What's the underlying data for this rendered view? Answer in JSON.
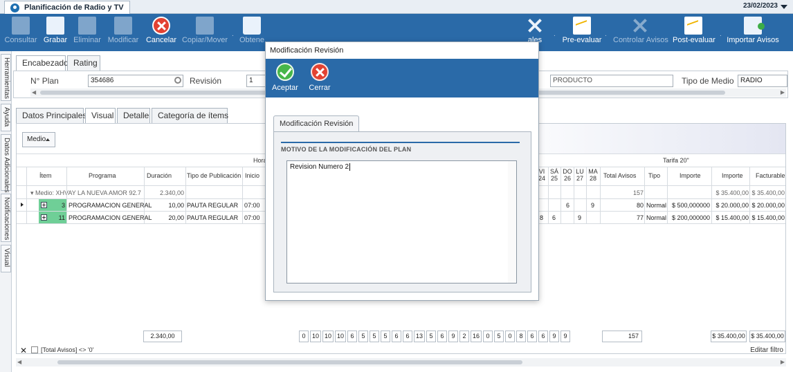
{
  "window": {
    "title": "Planificación de Radio y TV",
    "date": "23/02/2023"
  },
  "toolbar": {
    "buttons": [
      {
        "label": "Consultar",
        "icon": "consult-doc-icon"
      },
      {
        "label": "Grabar",
        "icon": "save-disk-icon"
      },
      {
        "label": "Eliminar",
        "icon": "delete-doc-icon"
      },
      {
        "label": "Modificar",
        "icon": "edit-doc-icon"
      },
      {
        "label": "Cancelar",
        "icon": "cancel-icon"
      },
      {
        "label": "Copiar/Mover",
        "icon": "copy-icon"
      },
      {
        "label": "Obtene",
        "icon": "folder-icon"
      },
      {
        "label": "ales",
        "icon": "tools-icon"
      },
      {
        "label": "Pre-evaluar",
        "icon": "chart-icon"
      },
      {
        "label": "Controlar Avisos",
        "icon": "tools-icon"
      },
      {
        "label": "Post-evaluar",
        "icon": "chart-icon"
      },
      {
        "label": "Importar Avisos",
        "icon": "import-icon"
      }
    ]
  },
  "sidetabs": [
    "Herramientas",
    "Ayuda",
    "Datos Adicionales",
    "Notificaciones",
    "Visual"
  ],
  "header_tabs": [
    "Encabezado",
    "Rating"
  ],
  "header": {
    "plan_label": "N° Plan",
    "plan_value": "354686",
    "revision_label": "Revisión",
    "revision_value": "1",
    "product_value": "PRODUCTO",
    "tipo_medio_label": "Tipo de Medio",
    "tipo_medio_value": "RADIO"
  },
  "sub_tabs": [
    "Datos Principales",
    "Visual",
    "Detalle",
    "Categoría de ítems"
  ],
  "grid": {
    "medio_button": "Medio",
    "band_hora": "Hora",
    "band_tarifa": "Tarifa 20\"",
    "columns_left": [
      "Ítem",
      "Programa",
      "Duración",
      "Tipo de Publicación",
      "Inicio"
    ],
    "day_columns": [
      "VI 24",
      "SÁ 25",
      "DO 26",
      "LU 27",
      "MA 28"
    ],
    "columns_right": [
      "Total Avisos",
      "Tipo",
      "Importe",
      "Importe",
      "Facturable"
    ],
    "group": {
      "label": "Medio: XHVAY LA NUEVA AMOR 92.7",
      "duracion": "2.340,00",
      "total_avisos": "157",
      "importe": "$ 35.400,00",
      "facturable": "$ 35.400,00"
    },
    "rows": [
      {
        "id": "3",
        "programa": "PROGRAMACION GENERAL",
        "duracion": "10,00",
        "tipo_pub": "PAUTA REGULAR",
        "inicio": "07:00",
        "days": [
          "",
          "",
          "6",
          "",
          "9"
        ],
        "total": "80",
        "tipo": "Normal",
        "importe_tarifa": "$ 500,000000",
        "importe": "$ 20.000,00",
        "facturable": "$ 20.000,00"
      },
      {
        "id": "11",
        "programa": "PROGRAMACION GENERAL",
        "duracion": "20,00",
        "tipo_pub": "PAUTA REGULAR",
        "inicio": "07:00",
        "days": [
          "8",
          "6",
          "",
          "9",
          ""
        ],
        "total": "77",
        "tipo": "Normal",
        "importe_tarifa": "$ 200,000000",
        "importe": "$ 15.400,00",
        "facturable": "$ 15.400,00"
      }
    ],
    "footer": {
      "duracion": "2.340,00",
      "day_totals": [
        "0",
        "10",
        "10",
        "10",
        "6",
        "5",
        "5",
        "5",
        "6",
        "6",
        "13",
        "5",
        "6",
        "9",
        "2",
        "16",
        "0",
        "5",
        "0",
        "8",
        "6",
        "6",
        "9",
        "9"
      ],
      "total_avisos": "157",
      "importe": "$ 35.400,00",
      "facturable": "$ 35.400,00"
    },
    "filter_text": "[Total Avisos] <> '0'",
    "edit_filter": "Editar filtro"
  },
  "modal": {
    "title": "Modificación Revisión",
    "accept": "Aceptar",
    "close": "Cerrar",
    "tab": "Modificación Revisión",
    "caption": "MOTIVO DE LA MODIFICACIÓN DEL PLAN",
    "text": "Revision Numero 2"
  }
}
